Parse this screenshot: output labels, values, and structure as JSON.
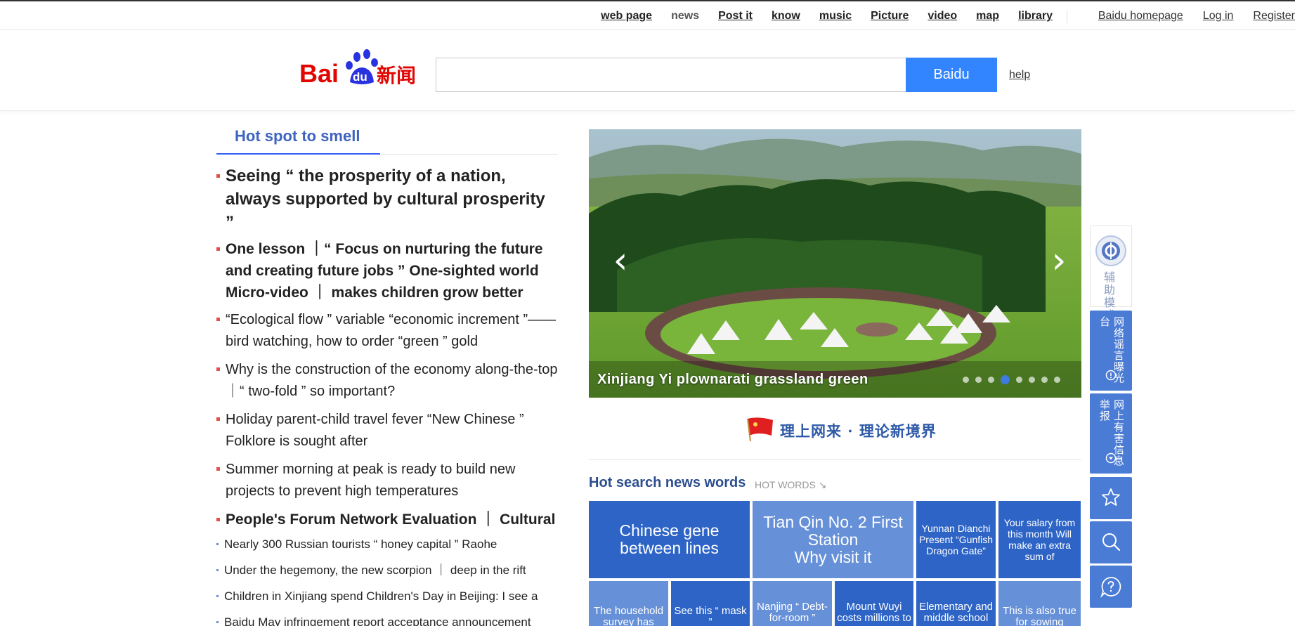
{
  "topnav": {
    "items": [
      "web page",
      "news",
      "Post it",
      "know",
      "music",
      "Picture",
      "video",
      "map",
      "library"
    ],
    "right": [
      "Baidu homepage",
      "Log in",
      "Register"
    ]
  },
  "logo": {
    "text_left": "Bai",
    "text_du": "du",
    "text_cn": "新闻"
  },
  "search": {
    "value": "",
    "button": "Baidu",
    "help": "help"
  },
  "left": {
    "tab": "Hot spot to smell",
    "headlines": [
      {
        "style": "big",
        "text": "Seeing “ the prosperity of a nation, always supported by cultural prosperity ”"
      },
      {
        "style": "bold",
        "text": "One lesson ｜“ Focus on nurturing the future and creating future jobs ” One-sighted world Micro-video ｜ makes children grow better"
      },
      {
        "style": "norm",
        "text": "“Ecological flow ” variable “economic increment ”——bird watching, how to order “green ” gold"
      },
      {
        "style": "norm",
        "text": "Why is the construction of the economy along-the-top ｜“ two-fold ” so important?"
      },
      {
        "style": "norm",
        "text": "Holiday parent-child travel fever “New Chinese ” Folklore is sought after"
      },
      {
        "style": "norm",
        "text": "Summer morning at peak is ready to build new projects to prevent high temperatures"
      }
    ],
    "section": "People's Forum Network Evaluation ｜ Cultural",
    "sublist": [
      "Nearly 300 Russian tourists “ honey capital ” Raohe",
      "Under the hegemony, the new scorpion ｜ deep in the rift",
      "Children in Xinjiang spend Children's Day in Beijing: I see a",
      "Baidu May infringement report acceptance announcement"
    ]
  },
  "carousel": {
    "caption": "Xinjiang Yi plownarati grassland green",
    "prev": "‹",
    "next": "›",
    "dot_count": 8,
    "active_dot": 3
  },
  "banner": {
    "text": "理上网来 · 理论新境界"
  },
  "hotsearch": {
    "title": "Hot search news words",
    "subtitle": "HOT WORDS",
    "arrow": "↘",
    "tiles": [
      "Chinese gene between lines",
      "Tian Qin No. 2 First Station\nWhy visit it",
      "Yunnan Dianchi Present “Gunfish Dragon Gate”",
      "Your salary from this month Will make an extra sum of",
      "The household survey has",
      "See this “ mask ”",
      "Nanjing “ Debt-for-room ”",
      "Mount Wuyi costs millions to",
      "Elementary and middle school",
      "This is also true for sowing"
    ]
  },
  "side": {
    "assist": "辅助模式",
    "rumor": "网络谣言曝光台",
    "report": "网上有害信息举报"
  },
  "colors": {
    "brand_red": "#e10602",
    "brand_blue": "#2932e1",
    "accent": "#3385ff",
    "tile_dark": "#2d64c6",
    "tile_light": "#6690d8"
  }
}
